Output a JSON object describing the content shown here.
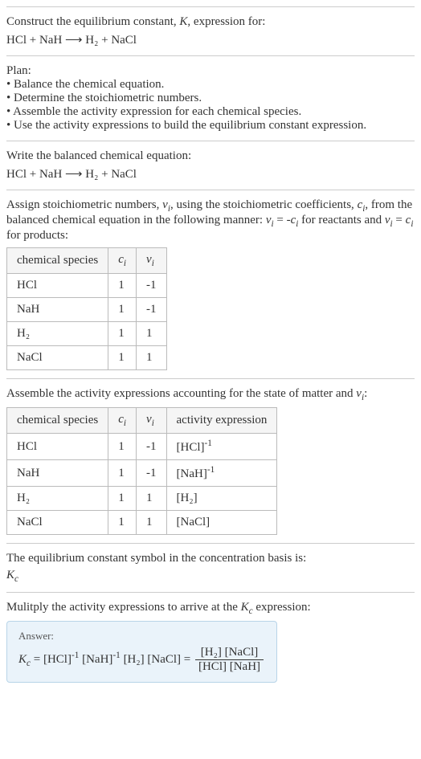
{
  "intro": {
    "line1": "Construct the equilibrium constant, K, expression for:",
    "equation": "HCl + NaH ⟶ H₂ + NaCl"
  },
  "plan": {
    "heading": "Plan:",
    "bullets": [
      "• Balance the chemical equation.",
      "• Determine the stoichiometric numbers.",
      "• Assemble the activity expression for each chemical species.",
      "• Use the activity expressions to build the equilibrium constant expression."
    ]
  },
  "balanced": {
    "heading": "Write the balanced chemical equation:",
    "equation": "HCl + NaH ⟶ H₂ + NaCl"
  },
  "stoich": {
    "text_a": "Assign stoichiometric numbers, νᵢ, using the stoichiometric coefficients, cᵢ, from the balanced chemical equation in the following manner: νᵢ = -cᵢ for reactants and νᵢ = cᵢ for products:",
    "headers": [
      "chemical species",
      "cᵢ",
      "νᵢ"
    ],
    "rows": [
      [
        "HCl",
        "1",
        "-1"
      ],
      [
        "NaH",
        "1",
        "-1"
      ],
      [
        "H₂",
        "1",
        "1"
      ],
      [
        "NaCl",
        "1",
        "1"
      ]
    ]
  },
  "activity": {
    "text": "Assemble the activity expressions accounting for the state of matter and νᵢ:",
    "headers": [
      "chemical species",
      "cᵢ",
      "νᵢ",
      "activity expression"
    ],
    "rows": [
      {
        "sp": "HCl",
        "c": "1",
        "v": "-1",
        "ae_base": "[HCl]",
        "ae_exp": "-1"
      },
      {
        "sp": "NaH",
        "c": "1",
        "v": "-1",
        "ae_base": "[NaH]",
        "ae_exp": "-1"
      },
      {
        "sp": "H₂",
        "c": "1",
        "v": "1",
        "ae_base": "[H₂]",
        "ae_exp": ""
      },
      {
        "sp": "NaCl",
        "c": "1",
        "v": "1",
        "ae_base": "[NaCl]",
        "ae_exp": ""
      }
    ]
  },
  "symbol": {
    "text": "The equilibrium constant symbol in the concentration basis is:",
    "value": "K_c"
  },
  "multiply": {
    "text": "Mulitply the activity expressions to arrive at the K_c expression:"
  },
  "answer": {
    "label": "Answer:",
    "lhs": "K_c = [HCl]^{-1} [NaH]^{-1} [H₂] [NaCl] =",
    "num": "[H₂] [NaCl]",
    "den": "[HCl] [NaH]"
  }
}
